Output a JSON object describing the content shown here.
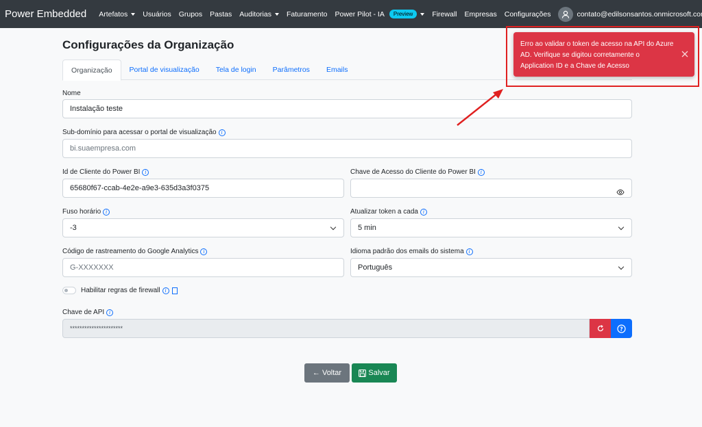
{
  "navbar": {
    "brand": "Power Embedded",
    "items": [
      {
        "label": "Artefatos",
        "dropdown": true
      },
      {
        "label": "Usuários",
        "dropdown": false
      },
      {
        "label": "Grupos",
        "dropdown": false
      },
      {
        "label": "Pastas",
        "dropdown": false
      },
      {
        "label": "Auditorias",
        "dropdown": true
      },
      {
        "label": "Faturamento",
        "dropdown": false
      },
      {
        "label": "Power Pilot - IA",
        "badge": "Preview",
        "dropdown": true
      },
      {
        "label": "Firewall",
        "dropdown": false
      },
      {
        "label": "Empresas",
        "dropdown": false
      },
      {
        "label": "Configurações",
        "dropdown": false
      }
    ],
    "user_email": "contato@edilsonsantos.onmicrosoft.com"
  },
  "page": {
    "title": "Configurações da Organização"
  },
  "tabs": [
    {
      "label": "Organização",
      "active": true
    },
    {
      "label": "Portal de visualização",
      "active": false
    },
    {
      "label": "Tela de login",
      "active": false
    },
    {
      "label": "Parâmetros",
      "active": false
    },
    {
      "label": "Emails",
      "active": false
    }
  ],
  "form": {
    "nome": {
      "label": "Nome",
      "value": "Instalação teste"
    },
    "subdominio": {
      "label": "Sub-domínio para acessar o portal de visualização",
      "placeholder": "bi.suaempresa.com"
    },
    "client_id": {
      "label": "Id de Cliente do Power BI",
      "value": "65680f67-ccab-4e2e-a9e3-635d3a3f0375"
    },
    "client_secret": {
      "label": "Chave de Acesso do Cliente do Power BI",
      "value": ""
    },
    "fuso": {
      "label": "Fuso horário",
      "value": "-3"
    },
    "token": {
      "label": "Atualizar token a cada",
      "value": "5 min"
    },
    "analytics": {
      "label": "Código de rastreamento do Google Analytics",
      "placeholder": "G-XXXXXXX"
    },
    "idioma": {
      "label": "Idioma padrão dos emails do sistema",
      "value": "Português"
    },
    "firewall": {
      "label": "Habilitar regras de firewall",
      "enabled": false
    },
    "api_key": {
      "label": "Chave de API",
      "value": "**********************"
    }
  },
  "buttons": {
    "back": "← Voltar",
    "save": "Salvar"
  },
  "toast": {
    "message": "Erro ao validar o token de acesso na API do Azure AD. Verifique se digitou corretamente o Application ID e a Chave de Acesso",
    "color": "#dc3545"
  },
  "icons": {
    "info": "info-circle-icon",
    "eye": "eye-icon",
    "refresh": "refresh-icon",
    "help": "question-circle-icon",
    "save": "floppy-disk-icon",
    "close": "close-icon"
  }
}
